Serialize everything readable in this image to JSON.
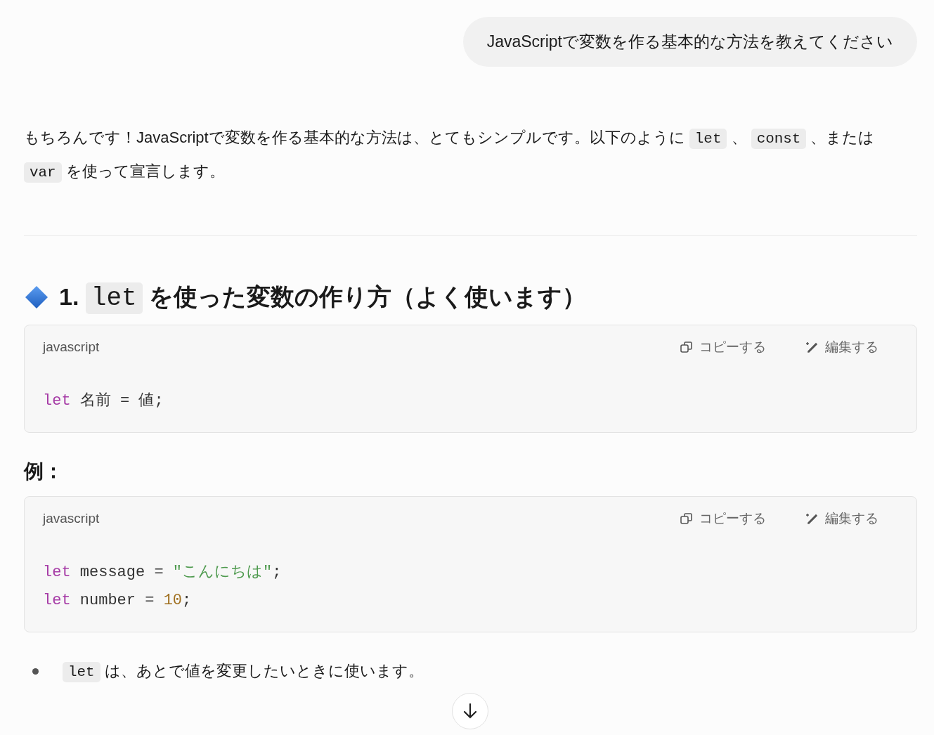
{
  "user_message": "JavaScriptで変数を作る基本的な方法を教えてください",
  "intro": [
    {
      "kind": "text",
      "text": "もちろんです！JavaScriptで変数を作る基本的な方法は、とてもシンプルです。以下のように "
    },
    {
      "kind": "code",
      "text": "let"
    },
    {
      "kind": "text",
      "text": " 、 "
    },
    {
      "kind": "code",
      "text": "const"
    },
    {
      "kind": "text",
      "text": " 、または "
    },
    {
      "kind": "code",
      "text": "var"
    },
    {
      "kind": "text",
      "text": " を使って宣言します。"
    }
  ],
  "heading": {
    "parts": [
      {
        "kind": "text",
        "text": "1. "
      },
      {
        "kind": "code",
        "text": "let"
      },
      {
        "kind": "text",
        "text": " を使った変数の作り方（よく使います）"
      }
    ]
  },
  "blocks": [
    {
      "kind": "code_block",
      "language": "javascript",
      "copy_label": "コピーする",
      "edit_label": "編集する",
      "lines": [
        [
          {
            "kind": "keyword",
            "text": "let"
          },
          {
            "kind": "plain",
            "text": " 名前 = 値;"
          }
        ]
      ]
    },
    {
      "kind": "subheading",
      "text": "例："
    },
    {
      "kind": "code_block",
      "language": "javascript",
      "copy_label": "コピーする",
      "edit_label": "編集する",
      "lines": [
        [
          {
            "kind": "keyword",
            "text": "let"
          },
          {
            "kind": "plain",
            "text": " message = "
          },
          {
            "kind": "string",
            "text": "\"こんにちは\""
          },
          {
            "kind": "plain",
            "text": ";"
          }
        ],
        [
          {
            "kind": "keyword",
            "text": "let"
          },
          {
            "kind": "plain",
            "text": " number = "
          },
          {
            "kind": "number",
            "text": "10"
          },
          {
            "kind": "plain",
            "text": ";"
          }
        ]
      ]
    },
    {
      "kind": "bullet",
      "parts": [
        {
          "kind": "code",
          "text": "let"
        },
        {
          "kind": "text",
          "text": " は、あとで値を変更したいときに使います。"
        }
      ]
    }
  ]
}
